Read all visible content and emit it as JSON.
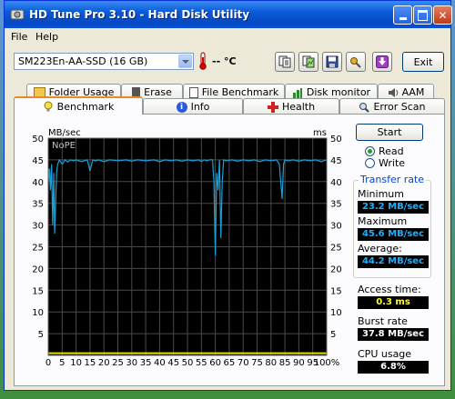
{
  "window": {
    "title": "HD Tune Pro 3.10 - Hard Disk Utility"
  },
  "menu": {
    "file": "File",
    "help": "Help"
  },
  "toolbar": {
    "drive": "SM223En-AA-SSD (16 GB)",
    "temperature": "-- °C",
    "exit_label": "Exit",
    "icons": [
      "copy-text-icon",
      "copy-screen-icon",
      "save-icon",
      "options-icon",
      "download-icon"
    ]
  },
  "tabs": {
    "back_row": [
      "Folder Usage",
      "Erase",
      "File Benchmark",
      "Disk monitor",
      "AAM"
    ],
    "front_row": [
      "Benchmark",
      "Info",
      "Health",
      "Error Scan"
    ],
    "active": "Benchmark"
  },
  "benchmark": {
    "start_label": "Start",
    "mode_read": "Read",
    "mode_write": "Write",
    "selected_mode": "Read",
    "transfer_rate_title": "Transfer rate",
    "minimum_label": "Minimum",
    "minimum_value": "23.2 MB/sec",
    "maximum_label": "Maximum",
    "maximum_value": "45.6 MB/sec",
    "average_label": "Average:",
    "average_value": "44.2 MB/sec",
    "access_time_label": "Access time:",
    "access_time_value": "0.3 ms",
    "burst_rate_label": "Burst rate",
    "burst_rate_value": "37.8 MB/sec",
    "cpu_usage_label": "CPU usage",
    "cpu_usage_value": "6.8%"
  },
  "colors": {
    "graph_bg": "#000000",
    "grid": "#4a4a4a",
    "transfer_line": "#1aa0d8",
    "access_line": "#e0e000",
    "read_radio": "#21a121"
  },
  "chart_data": {
    "type": "line",
    "title": "",
    "watermark": "NoPE",
    "left_unit": "MB/sec",
    "right_unit": "ms",
    "left_ticks": [
      "50",
      "45",
      "40",
      "35",
      "30",
      "25",
      "20",
      "15",
      "10",
      "5"
    ],
    "right_ticks": [
      "50",
      "45",
      "40",
      "35",
      "30",
      "25",
      "20",
      "15",
      "10",
      "5"
    ],
    "x_ticks": [
      "0",
      "5",
      "10",
      "15",
      "20",
      "25",
      "30",
      "35",
      "40",
      "45",
      "50",
      "55",
      "60",
      "65",
      "70",
      "75",
      "80",
      "85",
      "90",
      "95",
      "100%"
    ],
    "xlim": [
      0,
      100
    ],
    "ylim": [
      0,
      50
    ],
    "grid": true,
    "series": [
      {
        "name": "",
        "x": [
          0,
          0.4,
          0.8,
          1.2,
          1.6,
          2,
          2.3,
          2.7,
          3,
          3.4,
          4,
          5,
          6,
          7,
          8,
          9,
          10,
          12,
          14,
          15,
          16,
          17,
          18,
          20,
          22,
          25,
          28,
          30,
          32,
          35,
          38,
          40,
          42,
          44,
          46,
          48,
          50,
          52,
          54,
          55,
          56,
          57,
          58,
          59,
          59.5,
          60,
          60.5,
          61,
          61.5,
          62,
          62.5,
          63,
          64,
          66,
          68,
          70,
          72,
          74,
          76,
          78,
          80,
          82,
          83,
          83.5,
          84,
          84.5,
          85,
          86,
          88,
          90,
          92,
          94,
          96,
          98,
          100
        ],
        "y": [
          40,
          43,
          38,
          44,
          30,
          42,
          28,
          36,
          42,
          44,
          45,
          44,
          45,
          44.5,
          45,
          44.8,
          45,
          44.6,
          45,
          42.5,
          45,
          44.8,
          45,
          44.6,
          45,
          44.8,
          45,
          44.7,
          45,
          44.8,
          45,
          44.6,
          45,
          44.8,
          45,
          44.7,
          45,
          44.8,
          45,
          44.6,
          45,
          44.8,
          45,
          45,
          40,
          23,
          42,
          38,
          45,
          27,
          40,
          45,
          44.8,
          45,
          44.7,
          45,
          44.8,
          45,
          44.6,
          45,
          44.8,
          45,
          44,
          40,
          36,
          44,
          45,
          44.8,
          45,
          44.7,
          45,
          44.8,
          45,
          44.6,
          45
        ]
      },
      {
        "name": "",
        "x": [
          0,
          10,
          20,
          30,
          40,
          50,
          60,
          70,
          80,
          90,
          100
        ],
        "y": [
          0.3,
          0.3,
          0.3,
          0.3,
          0.3,
          0.3,
          0.3,
          0.3,
          0.3,
          0.3,
          0.3
        ]
      }
    ]
  }
}
